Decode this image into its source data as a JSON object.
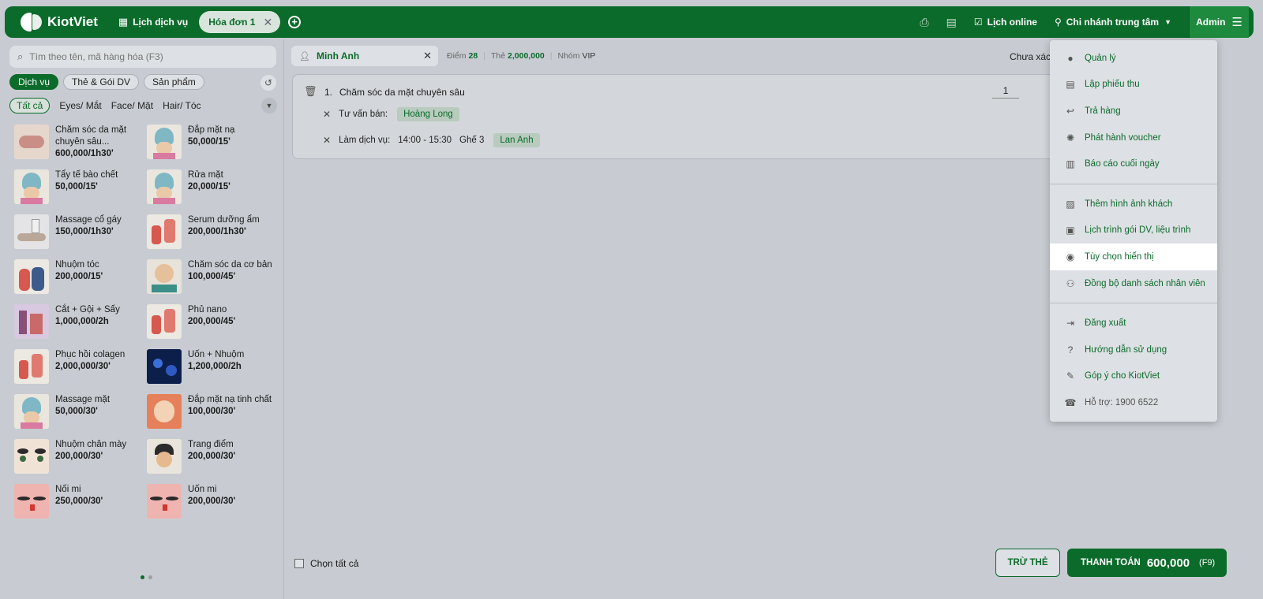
{
  "topbar": {
    "brand": "KiotViet",
    "nav_schedule": "Lịch dịch vụ",
    "tab_invoice": "Hóa đơn 1",
    "online_schedule": "Lịch online",
    "branch": "Chi nhánh trung tâm",
    "admin": "Admin"
  },
  "left": {
    "search_placeholder": "Tìm theo tên, mã hàng hóa (F3)",
    "categories": [
      "Dịch vụ",
      "Thẻ & Gói DV",
      "Sản phẩm"
    ],
    "subcategories": [
      "Tất cả",
      "Eyes/ Mắt",
      "Face/ Mặt",
      "Hair/ Tóc"
    ],
    "products": [
      {
        "name": "Chăm sóc da mặt chuyên sâu...",
        "price": "600,000/1h30'"
      },
      {
        "name": "Đắp mặt nạ",
        "price": "50,000/15'"
      },
      {
        "name": "Tẩy tế bào chết",
        "price": "50,000/15'"
      },
      {
        "name": "Rửa mặt",
        "price": "20,000/15'"
      },
      {
        "name": "Massage cổ gáy",
        "price": "150,000/1h30'"
      },
      {
        "name": "Serum dưỡng ẩm",
        "price": "200,000/1h30'"
      },
      {
        "name": "Nhuộm tóc",
        "price": "200,000/15'"
      },
      {
        "name": "Chăm sóc da cơ bản",
        "price": "100,000/45'"
      },
      {
        "name": "Cắt + Gội + Sấy",
        "price": "1,000,000/2h"
      },
      {
        "name": "Phủ nano",
        "price": "200,000/45'"
      },
      {
        "name": "Phục hồi colagen",
        "price": "2,000,000/30'"
      },
      {
        "name": "Uốn + Nhuộm",
        "price": "1,200,000/2h"
      },
      {
        "name": "Massage mặt",
        "price": "50,000/30'"
      },
      {
        "name": "Đắp mặt nạ tinh chất",
        "price": "100,000/30'"
      },
      {
        "name": "Nhuộm chân mày",
        "price": "200,000/30'"
      },
      {
        "name": "Trang điểm",
        "price": "200,000/30'"
      },
      {
        "name": "Nối mi",
        "price": "250,000/30'"
      },
      {
        "name": "Uốn mi",
        "price": "200,000/30'"
      }
    ]
  },
  "order": {
    "customer": "Minh Anh",
    "points_label": "Điểm",
    "points": "28",
    "card_label": "Thẻ",
    "card": "2,000,000",
    "group_label": "Nhóm",
    "group": "VIP",
    "status": "Chưa xác",
    "line_no": "1.",
    "line_name": "Chăm sóc da mặt chuyên sâu",
    "qty": "1",
    "consultant_label": "Tư vấn bán:",
    "consultant": "Hoàng Long",
    "service_label": "Làm dịch vụ:",
    "service_time": "14:00 - 15:30",
    "chair": "Ghế 3",
    "staff": "Lan Anh",
    "select_all": "Chọn tất cả",
    "btn_card": "TRỪ THẺ",
    "btn_pay": "THANH TOÁN",
    "total": "600,000",
    "pay_key": "(F9)"
  },
  "menu": {
    "group1": [
      "Quản lý",
      "Lập phiếu thu",
      "Trả hàng",
      "Phát hành voucher",
      "Báo cáo cuối ngày"
    ],
    "group2": [
      "Thêm hình ảnh khách",
      "Lịch trình gói DV, liệu trình",
      "Tùy chọn hiển thị",
      "Đồng bộ danh sách nhân viên"
    ],
    "group3": [
      "Đăng xuất",
      "Hướng dẫn sử dụng",
      "Góp ý cho KiotViet",
      "Hỗ trợ: 1900 6522"
    ]
  }
}
